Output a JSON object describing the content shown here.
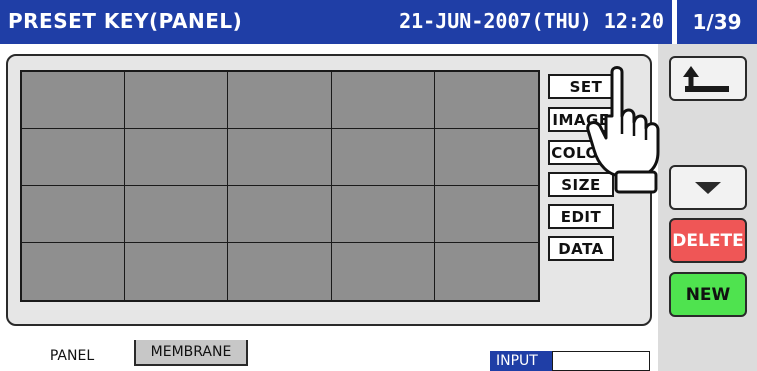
{
  "header": {
    "title": "PRESET KEY(PANEL)",
    "datetime": "21-JUN-2007(THU) 12:20",
    "page": "1/39"
  },
  "grid": {
    "rows": 4,
    "cols": 5
  },
  "side_buttons": [
    {
      "id": "set",
      "label": "SET",
      "checked": true
    },
    {
      "id": "image",
      "label": "IMAGE"
    },
    {
      "id": "color",
      "label": "COLOR"
    },
    {
      "id": "size",
      "label": "SIZE"
    },
    {
      "id": "edit",
      "label": "EDIT"
    },
    {
      "id": "data",
      "label": "DATA"
    }
  ],
  "nav": {
    "back_icon": "back-arrow-icon",
    "down_icon": "down-arrow-icon",
    "delete_label": "DELETE",
    "new_label": "NEW"
  },
  "tabs": [
    {
      "label": "PANEL",
      "active": true
    },
    {
      "label": "MEMBRANE",
      "active": false
    }
  ],
  "input": {
    "label": "INPUT",
    "value": ""
  },
  "colors": {
    "header_blue": "#1f3ea6",
    "delete_red": "#ef5656",
    "new_green": "#4fe34f",
    "check_green": "#3fbf2f"
  }
}
